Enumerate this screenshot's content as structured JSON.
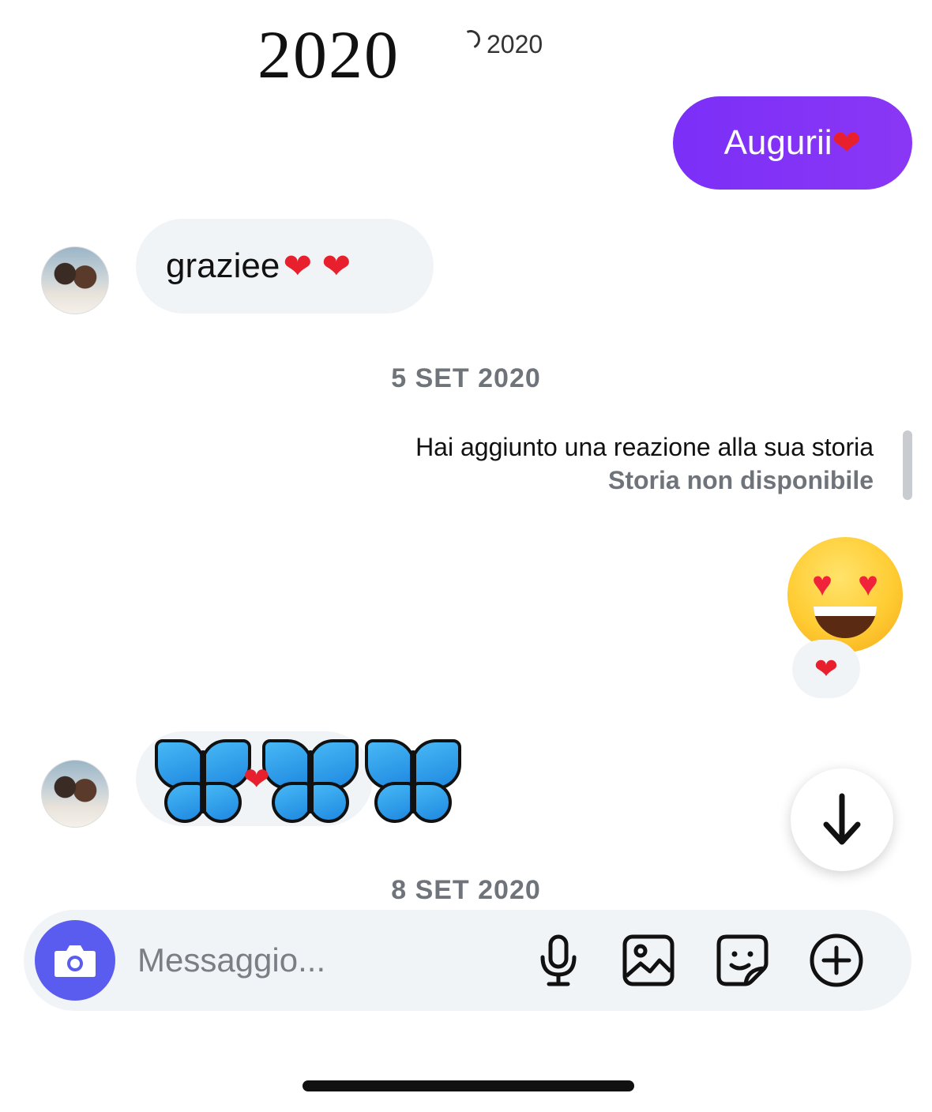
{
  "sticker": {
    "text": "2020",
    "year": "2020"
  },
  "messages": {
    "sent_1": {
      "text": "Augurii",
      "emoji": "❤"
    },
    "received_1": {
      "text": "graziee",
      "emoji": "❤ ❤"
    },
    "date_1": "5 SET 2020",
    "story_reaction": {
      "title": "Hai aggiunto una reazione alla sua storia",
      "subtitle": "Storia non disponibile",
      "reaction_emoji": "heart-eyes",
      "reaction_chip": "❤"
    },
    "received_2": {
      "content": "butterflies-and-heart",
      "heart": "❤"
    },
    "date_2": "8 SET 2020"
  },
  "composer": {
    "placeholder": "Messaggio...",
    "value": ""
  },
  "icons": {
    "camera": "camera-icon",
    "mic": "microphone-icon",
    "gallery": "image-icon",
    "sticker": "sticker-icon",
    "plus": "plus-circle-icon",
    "scroll": "arrow-down-icon"
  },
  "colors": {
    "sent_bubble": "#7b2ff7",
    "received_bubble": "#f1f4f6",
    "camera_button": "#5a5cf0",
    "secondary_text": "#6f747a"
  }
}
